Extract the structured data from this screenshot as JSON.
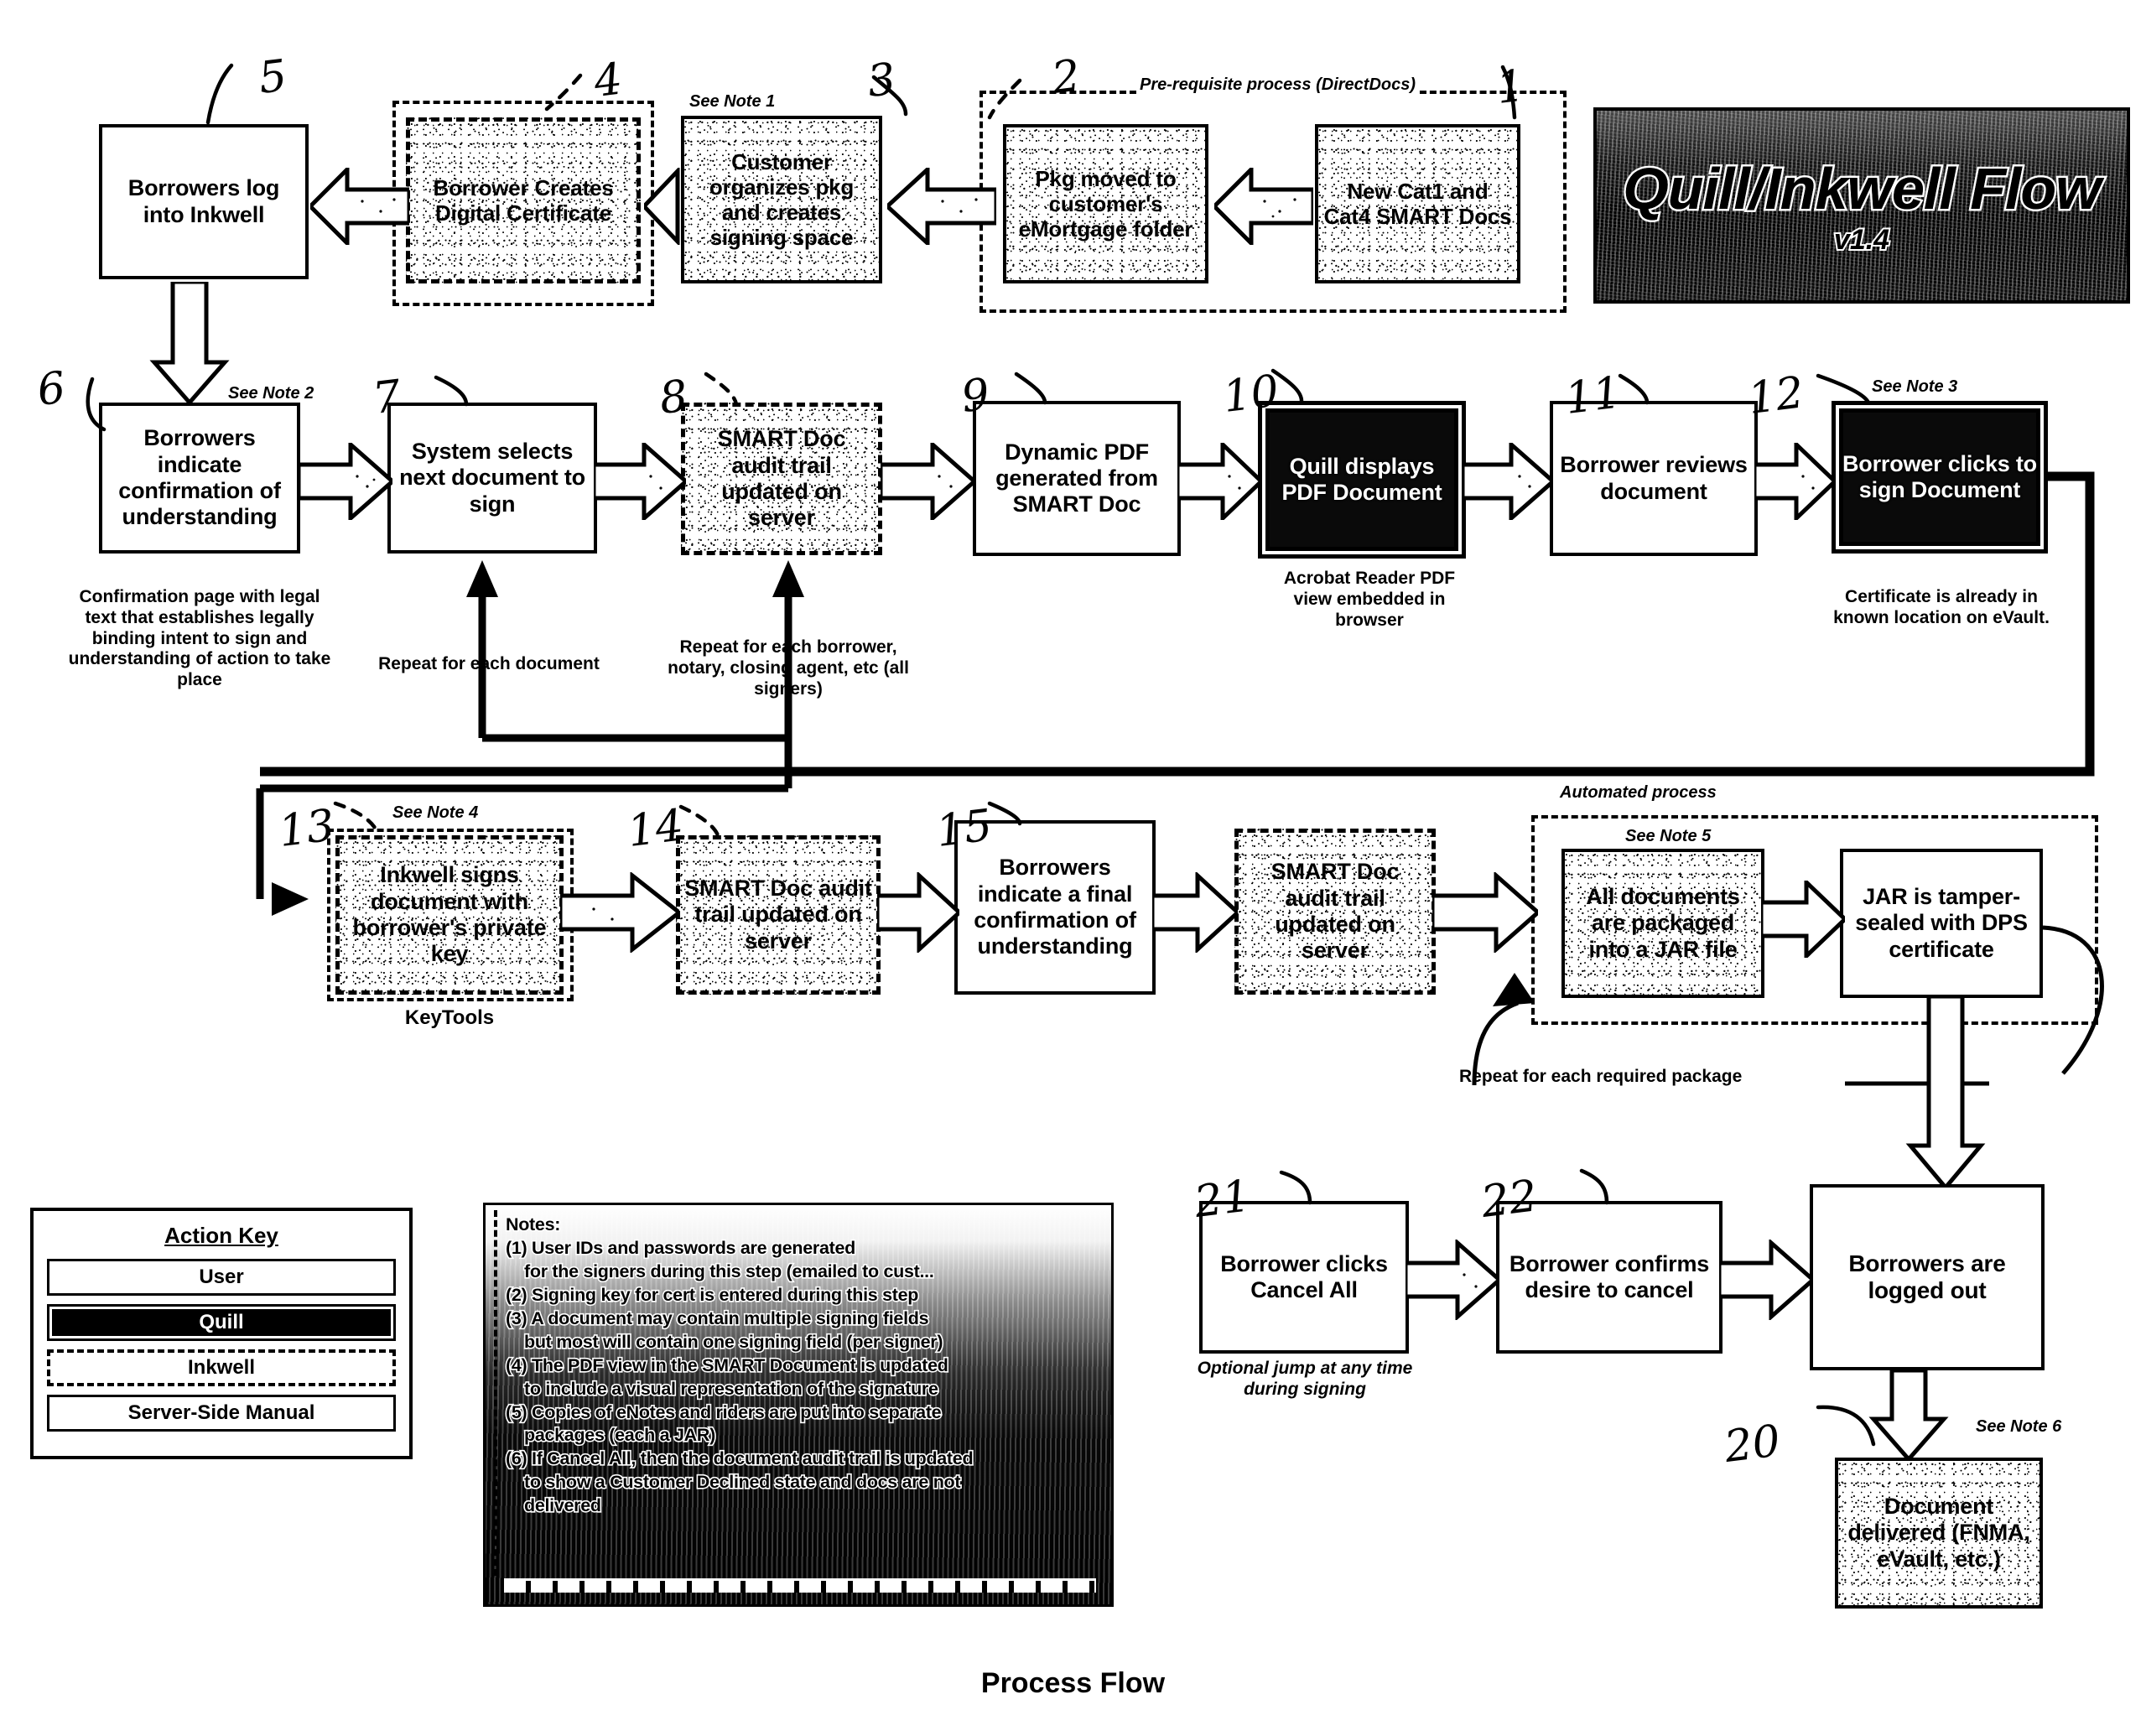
{
  "diagram": {
    "footer_title": "Process Flow",
    "banner": {
      "title": "Quill/Inkwell Flow",
      "version": "v1.4"
    }
  },
  "groups": [
    {
      "id": "prereq",
      "label": "Pre-requisite process (DirectDocs)"
    },
    {
      "id": "automated",
      "label": "Automated process"
    }
  ],
  "callouts": {
    "c1": "1",
    "c2": "2",
    "c3": "3",
    "c4": "4",
    "c5": "5",
    "c6": "6",
    "c7": "7",
    "c8": "8",
    "c9": "9",
    "c10": "10",
    "c11": "11",
    "c12": "12",
    "c13": "13",
    "c14": "14",
    "c15": "15",
    "c20": "20",
    "c21": "21",
    "c22": "22"
  },
  "nodes": {
    "n1": {
      "text": "New Cat1 and Cat4 SMART Docs",
      "style": "speckle"
    },
    "n2": {
      "text": "Pkg moved to customer's eMortgage folder",
      "style": "speckle"
    },
    "n3": {
      "text": "Customer organizes pkg and creates signing space",
      "style": "speckle"
    },
    "n4": {
      "text": "Borrower Creates Digital Certificate",
      "style": "dashed-speckle"
    },
    "n5": {
      "text": "Borrowers log into Inkwell",
      "style": "plain"
    },
    "n6": {
      "text": "Borrowers indicate confirmation of understanding",
      "style": "plain"
    },
    "n7": {
      "text": "System selects next document to sign",
      "style": "plain"
    },
    "n8": {
      "text": "SMART Doc audit trail updated on server",
      "style": "dashed-speckle"
    },
    "n9": {
      "text": "Dynamic PDF generated from SMART Doc",
      "style": "plain"
    },
    "n10": {
      "text": "Quill displays PDF Document",
      "style": "dark"
    },
    "n11": {
      "text": "Borrower reviews document",
      "style": "plain"
    },
    "n12": {
      "text": "Borrower clicks to sign Document",
      "style": "dark"
    },
    "n13": {
      "text": "Inkwell signs document with borrower's private key",
      "style": "dashed-speckle"
    },
    "n14": {
      "text": "SMART Doc audit trail updated on server",
      "style": "dashed-speckle"
    },
    "n15": {
      "text": "Borrowers indicate a final confirmation of understanding",
      "style": "plain"
    },
    "n16": {
      "text": "SMART Doc audit trail updated on server",
      "style": "dashed-speckle"
    },
    "n17": {
      "text": "All documents are packaged into a JAR file",
      "style": "plain"
    },
    "n18": {
      "text": "JAR is tamper-sealed with DPS certificate",
      "style": "plain"
    },
    "n19": {
      "text": "Borrowers are logged out",
      "style": "plain"
    },
    "n20": {
      "text": "Document delivered (FNMA, eVault, etc.)",
      "style": "plain"
    },
    "n21": {
      "text": "Borrower clicks Cancel All",
      "style": "plain"
    },
    "n22": {
      "text": "Borrower confirms desire to cancel",
      "style": "plain"
    }
  },
  "note_refs": {
    "r1": "See Note 1",
    "r2": "See Note 2",
    "r3": "See Note 3",
    "r4": "See Note 4",
    "r5": "See Note 5",
    "r6": "See Note 6"
  },
  "annotations": {
    "confirmation_page": "Confirmation page with legal text that establishes legally binding intent to sign and understanding of action to take place",
    "repeat_document": "Repeat for each document",
    "repeat_signers": "Repeat for each borrower, notary, closing agent, etc (all signers)",
    "acrobat": "Acrobat Reader PDF view embedded in browser",
    "certificate": "Certificate is already in known location on eVault.",
    "keytools": "KeyTools",
    "repeat_package": "Repeat for each required package",
    "optional_jump": "Optional jump at any time during signing"
  },
  "action_key": {
    "title": "Action Key",
    "rows": [
      {
        "label": "User",
        "style": "solid"
      },
      {
        "label": "Quill",
        "style": "dark"
      },
      {
        "label": "Inkwell",
        "style": "dashed"
      },
      {
        "label": "Server-Side Manual",
        "style": "solid"
      }
    ]
  },
  "notes": {
    "heading": "Notes:",
    "items": [
      "(1) User IDs and passwords are generated",
      "for the signers during this step (emailed to cust...",
      "(2) Signing key for cert is entered during this step",
      "(3) A document may contain multiple signing fields",
      "but most will contain one signing field (per signer)",
      "(4) The PDF view in the SMART Document is updated",
      "to include a visual representation of the signature",
      "(5) Copies of eNotes and riders are put into separate",
      "packages (each a JAR)",
      "(6) If Cancel All, then the document audit trail is updated",
      "to show a Customer Declined state and docs are not",
      "delivered"
    ]
  },
  "colors": {
    "ink": "#000000",
    "paper": "#ffffff",
    "quill_fill": "#0a0a0a"
  }
}
